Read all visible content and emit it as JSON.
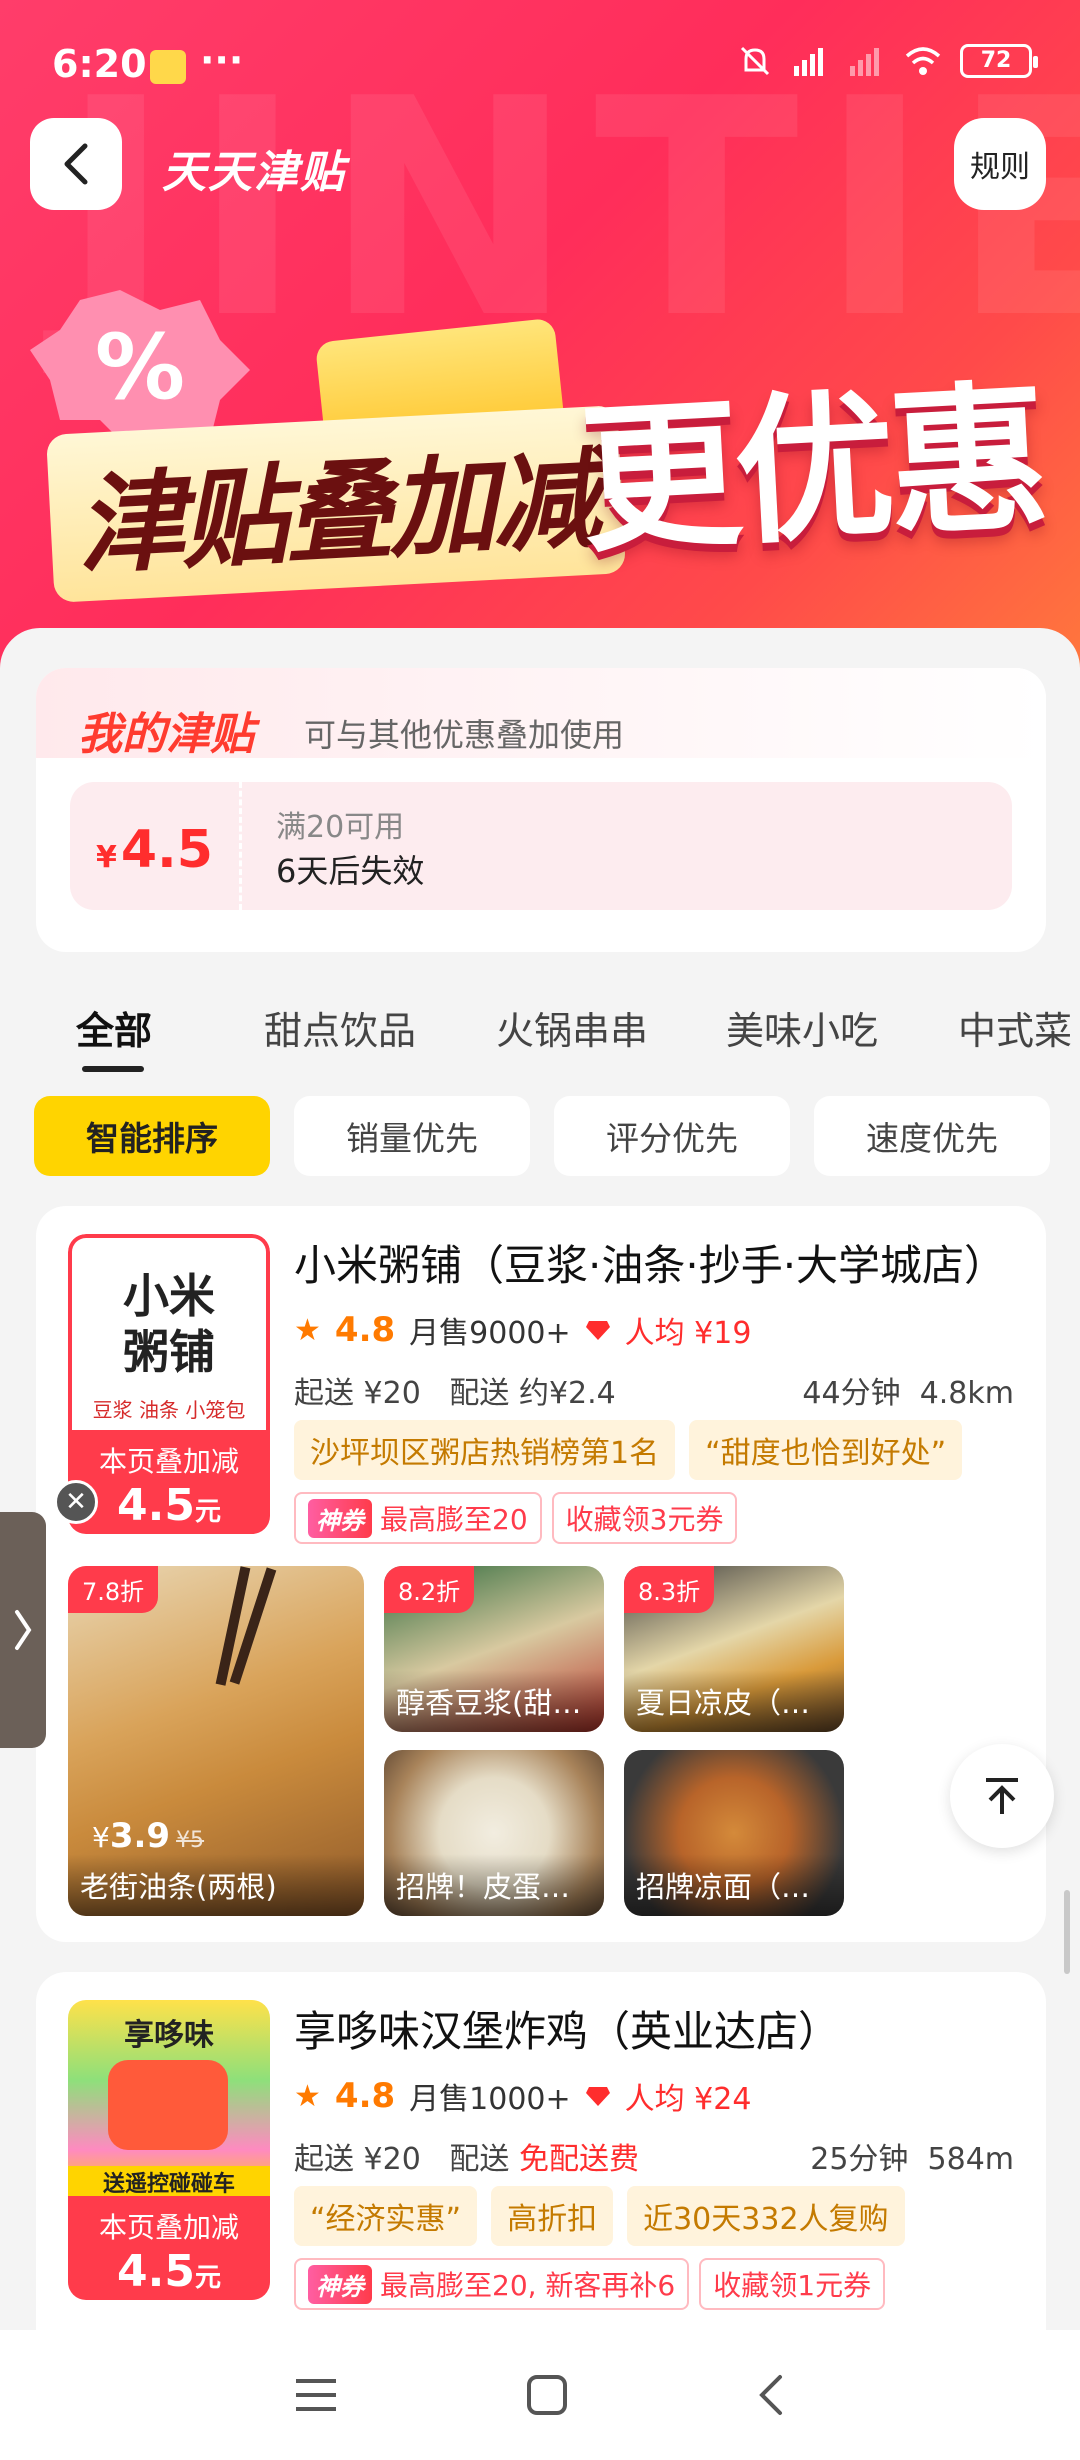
{
  "status": {
    "time": "6:20",
    "dots": "···",
    "battery": "72"
  },
  "header": {
    "title": "天天津贴",
    "rules_label": "规则",
    "watermark": "JINTIE"
  },
  "banner": {
    "slogan_left": "津贴叠加减",
    "slogan_right": "更优惠",
    "percent": "%"
  },
  "subsidy": {
    "title": "我的津贴",
    "description": "可与其他优惠叠加使用",
    "coupon": {
      "currency": "¥",
      "amount": "4.5",
      "condition": "满20可用",
      "expiry": "6天后失效"
    }
  },
  "tabs": [
    "全部",
    "甜点饮品",
    "火锅串串",
    "美味小吃",
    "中式菜"
  ],
  "sort": [
    "智能排序",
    "销量优先",
    "评分优先",
    "速度优先"
  ],
  "stores": [
    {
      "logo_text_line1": "小米",
      "logo_text_line2": "粥铺",
      "logo_sub": "豆浆  油条  小笼包",
      "badge_label": "本页叠加减",
      "badge_amount": "4.5",
      "badge_unit": "元",
      "name": "小米粥铺（豆浆·油条·抄手·大学城店）",
      "rating": "4.8",
      "monthly_sales": "月售9000+",
      "avg_price": "人均 ¥19",
      "min_order": "起送 ¥20",
      "delivery_fee_label": "配送",
      "delivery_fee": "约¥2.4",
      "time": "44分钟",
      "distance": "4.8km",
      "tags": [
        "沙坪坝区粥店热销榜第1名",
        "“甜度也恰到好处”"
      ],
      "promo_tag": "神券",
      "promos": [
        "最高膨至20",
        "收藏领3元券"
      ],
      "dishes": [
        {
          "discount": "7.8折",
          "name": "老街油条(两根)",
          "price": "3.9",
          "orig": "¥5",
          "currency": "¥"
        },
        {
          "discount": "8.2折",
          "name": "醇香豆浆(甜…"
        },
        {
          "discount": "8.3折",
          "name": "夏日凉皮（…"
        },
        {
          "discount": "",
          "name": "招牌！皮蛋…"
        },
        {
          "discount": "",
          "name": "招牌凉面（…"
        }
      ]
    },
    {
      "logo_text_line1": "享哆味",
      "logo_sub": "送遥控碰碰车",
      "badge_label": "本页叠加减",
      "badge_amount": "4.5",
      "badge_unit": "元",
      "name": "享哆味汉堡炸鸡（英业达店）",
      "rating": "4.8",
      "monthly_sales": "月售1000+",
      "avg_price": "人均 ¥24",
      "min_order": "起送 ¥20",
      "delivery_fee_label": "配送",
      "delivery_fee": "免配送费",
      "time": "25分钟",
      "distance": "584m",
      "tags": [
        "“经济实惠”",
        "高折扣",
        "近30天332人复购"
      ],
      "promo_tag": "神券",
      "promos": [
        "最高膨至20, 新客再补6",
        "收藏领1元券"
      ]
    }
  ],
  "colors": {
    "accent": "#ff3b4b",
    "sort_active": "#ffd400",
    "rating": "#ff7a00"
  }
}
